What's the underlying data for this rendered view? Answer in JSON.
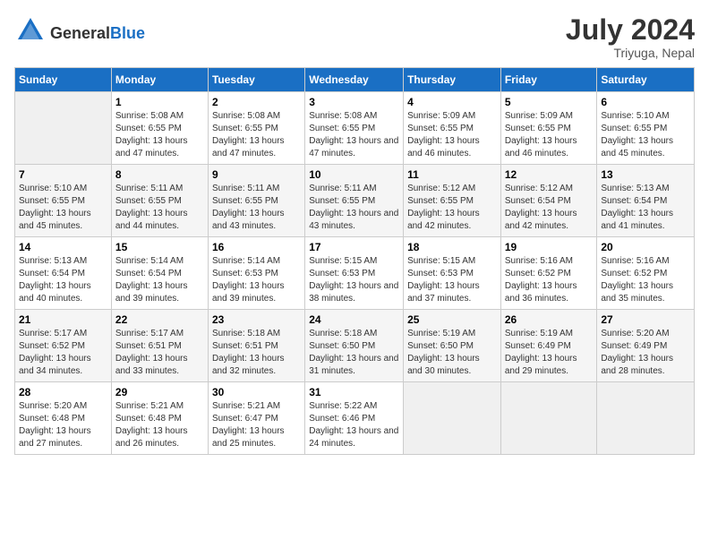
{
  "header": {
    "logo_general": "General",
    "logo_blue": "Blue",
    "month_year": "July 2024",
    "location": "Triyuga, Nepal"
  },
  "calendar": {
    "weekdays": [
      "Sunday",
      "Monday",
      "Tuesday",
      "Wednesday",
      "Thursday",
      "Friday",
      "Saturday"
    ],
    "weeks": [
      [
        {
          "day": "",
          "sunrise": "",
          "sunset": "",
          "daylight": ""
        },
        {
          "day": "1",
          "sunrise": "Sunrise: 5:08 AM",
          "sunset": "Sunset: 6:55 PM",
          "daylight": "Daylight: 13 hours and 47 minutes."
        },
        {
          "day": "2",
          "sunrise": "Sunrise: 5:08 AM",
          "sunset": "Sunset: 6:55 PM",
          "daylight": "Daylight: 13 hours and 47 minutes."
        },
        {
          "day": "3",
          "sunrise": "Sunrise: 5:08 AM",
          "sunset": "Sunset: 6:55 PM",
          "daylight": "Daylight: 13 hours and 47 minutes."
        },
        {
          "day": "4",
          "sunrise": "Sunrise: 5:09 AM",
          "sunset": "Sunset: 6:55 PM",
          "daylight": "Daylight: 13 hours and 46 minutes."
        },
        {
          "day": "5",
          "sunrise": "Sunrise: 5:09 AM",
          "sunset": "Sunset: 6:55 PM",
          "daylight": "Daylight: 13 hours and 46 minutes."
        },
        {
          "day": "6",
          "sunrise": "Sunrise: 5:10 AM",
          "sunset": "Sunset: 6:55 PM",
          "daylight": "Daylight: 13 hours and 45 minutes."
        }
      ],
      [
        {
          "day": "7",
          "sunrise": "Sunrise: 5:10 AM",
          "sunset": "Sunset: 6:55 PM",
          "daylight": "Daylight: 13 hours and 45 minutes."
        },
        {
          "day": "8",
          "sunrise": "Sunrise: 5:11 AM",
          "sunset": "Sunset: 6:55 PM",
          "daylight": "Daylight: 13 hours and 44 minutes."
        },
        {
          "day": "9",
          "sunrise": "Sunrise: 5:11 AM",
          "sunset": "Sunset: 6:55 PM",
          "daylight": "Daylight: 13 hours and 43 minutes."
        },
        {
          "day": "10",
          "sunrise": "Sunrise: 5:11 AM",
          "sunset": "Sunset: 6:55 PM",
          "daylight": "Daylight: 13 hours and 43 minutes."
        },
        {
          "day": "11",
          "sunrise": "Sunrise: 5:12 AM",
          "sunset": "Sunset: 6:55 PM",
          "daylight": "Daylight: 13 hours and 42 minutes."
        },
        {
          "day": "12",
          "sunrise": "Sunrise: 5:12 AM",
          "sunset": "Sunset: 6:54 PM",
          "daylight": "Daylight: 13 hours and 42 minutes."
        },
        {
          "day": "13",
          "sunrise": "Sunrise: 5:13 AM",
          "sunset": "Sunset: 6:54 PM",
          "daylight": "Daylight: 13 hours and 41 minutes."
        }
      ],
      [
        {
          "day": "14",
          "sunrise": "Sunrise: 5:13 AM",
          "sunset": "Sunset: 6:54 PM",
          "daylight": "Daylight: 13 hours and 40 minutes."
        },
        {
          "day": "15",
          "sunrise": "Sunrise: 5:14 AM",
          "sunset": "Sunset: 6:54 PM",
          "daylight": "Daylight: 13 hours and 39 minutes."
        },
        {
          "day": "16",
          "sunrise": "Sunrise: 5:14 AM",
          "sunset": "Sunset: 6:53 PM",
          "daylight": "Daylight: 13 hours and 39 minutes."
        },
        {
          "day": "17",
          "sunrise": "Sunrise: 5:15 AM",
          "sunset": "Sunset: 6:53 PM",
          "daylight": "Daylight: 13 hours and 38 minutes."
        },
        {
          "day": "18",
          "sunrise": "Sunrise: 5:15 AM",
          "sunset": "Sunset: 6:53 PM",
          "daylight": "Daylight: 13 hours and 37 minutes."
        },
        {
          "day": "19",
          "sunrise": "Sunrise: 5:16 AM",
          "sunset": "Sunset: 6:52 PM",
          "daylight": "Daylight: 13 hours and 36 minutes."
        },
        {
          "day": "20",
          "sunrise": "Sunrise: 5:16 AM",
          "sunset": "Sunset: 6:52 PM",
          "daylight": "Daylight: 13 hours and 35 minutes."
        }
      ],
      [
        {
          "day": "21",
          "sunrise": "Sunrise: 5:17 AM",
          "sunset": "Sunset: 6:52 PM",
          "daylight": "Daylight: 13 hours and 34 minutes."
        },
        {
          "day": "22",
          "sunrise": "Sunrise: 5:17 AM",
          "sunset": "Sunset: 6:51 PM",
          "daylight": "Daylight: 13 hours and 33 minutes."
        },
        {
          "day": "23",
          "sunrise": "Sunrise: 5:18 AM",
          "sunset": "Sunset: 6:51 PM",
          "daylight": "Daylight: 13 hours and 32 minutes."
        },
        {
          "day": "24",
          "sunrise": "Sunrise: 5:18 AM",
          "sunset": "Sunset: 6:50 PM",
          "daylight": "Daylight: 13 hours and 31 minutes."
        },
        {
          "day": "25",
          "sunrise": "Sunrise: 5:19 AM",
          "sunset": "Sunset: 6:50 PM",
          "daylight": "Daylight: 13 hours and 30 minutes."
        },
        {
          "day": "26",
          "sunrise": "Sunrise: 5:19 AM",
          "sunset": "Sunset: 6:49 PM",
          "daylight": "Daylight: 13 hours and 29 minutes."
        },
        {
          "day": "27",
          "sunrise": "Sunrise: 5:20 AM",
          "sunset": "Sunset: 6:49 PM",
          "daylight": "Daylight: 13 hours and 28 minutes."
        }
      ],
      [
        {
          "day": "28",
          "sunrise": "Sunrise: 5:20 AM",
          "sunset": "Sunset: 6:48 PM",
          "daylight": "Daylight: 13 hours and 27 minutes."
        },
        {
          "day": "29",
          "sunrise": "Sunrise: 5:21 AM",
          "sunset": "Sunset: 6:48 PM",
          "daylight": "Daylight: 13 hours and 26 minutes."
        },
        {
          "day": "30",
          "sunrise": "Sunrise: 5:21 AM",
          "sunset": "Sunset: 6:47 PM",
          "daylight": "Daylight: 13 hours and 25 minutes."
        },
        {
          "day": "31",
          "sunrise": "Sunrise: 5:22 AM",
          "sunset": "Sunset: 6:46 PM",
          "daylight": "Daylight: 13 hours and 24 minutes."
        },
        {
          "day": "",
          "sunrise": "",
          "sunset": "",
          "daylight": ""
        },
        {
          "day": "",
          "sunrise": "",
          "sunset": "",
          "daylight": ""
        },
        {
          "day": "",
          "sunrise": "",
          "sunset": "",
          "daylight": ""
        }
      ]
    ]
  }
}
